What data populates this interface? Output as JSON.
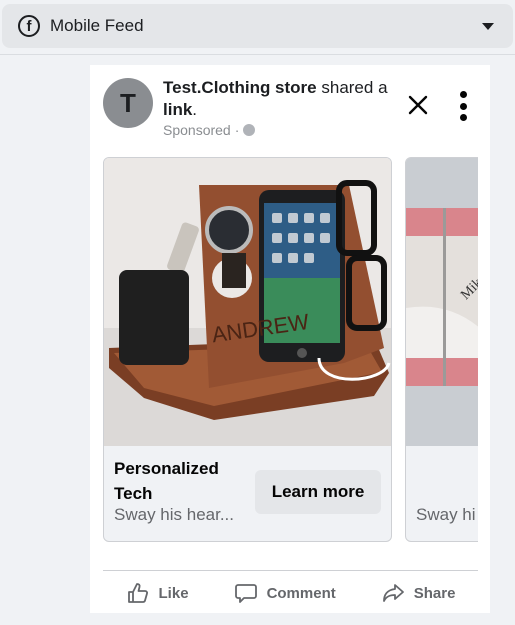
{
  "topbar": {
    "icon": "facebook-icon",
    "title": "Mobile Feed",
    "dropdown_icon": "caret-down-icon"
  },
  "post": {
    "avatar_letter": "T",
    "page_name": "Test.Clothing store",
    "action_text": " shared a ",
    "link_text": "link",
    "period": ".",
    "sponsored_label": "Sponsored",
    "separator": "·",
    "privacy_icon": "globe-icon",
    "close_icon": "close-icon",
    "more_icon": "more-options-icon"
  },
  "carousel": {
    "slides": [
      {
        "image_desc": "Wooden personalized docking station engraved ANDREW with phone, watch, keys, wallet and glasses",
        "engraving": "ANDREW",
        "title": "Personalized Tech",
        "description": "Sway his hear...",
        "cta_label": "Learn more"
      },
      {
        "image_desc": "Open book with pink edges",
        "description": "Sway hi"
      }
    ]
  },
  "actions": {
    "like": "Like",
    "comment": "Comment",
    "share": "Share"
  },
  "colors": {
    "page_bg": "#f0f2f5",
    "topbar_bg": "#e4e6e9",
    "text_primary": "#050505",
    "text_secondary": "#65676b",
    "cta_bg": "#e4e6e9"
  }
}
